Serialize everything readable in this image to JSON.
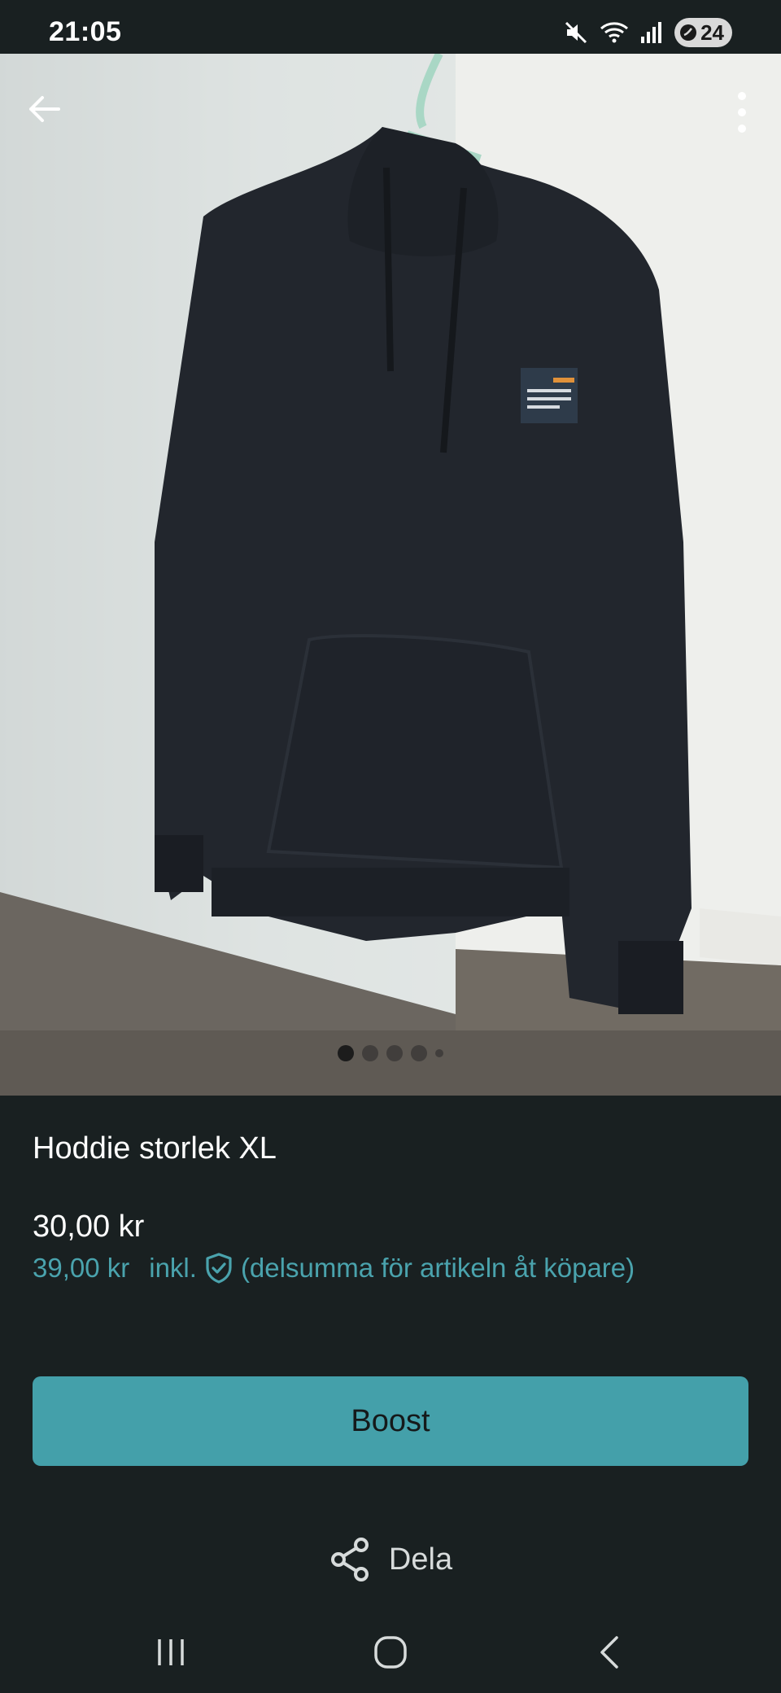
{
  "status_bar": {
    "time": "21:05",
    "battery": "24",
    "icons": [
      "mute-icon",
      "wifi-icon",
      "signal-icon",
      "battery-saver-icon"
    ]
  },
  "photo": {
    "icons": {
      "back": "arrow-left-icon",
      "more": "more-vertical-icon"
    },
    "page_count": 5,
    "current_page": 1
  },
  "product": {
    "title": "Hoddie storlek XL",
    "price": "30,00 kr",
    "price_incl_amount": "39,00 kr",
    "price_incl_word": "inkl.",
    "price_incl_note": "(delsumma för artikeln åt köpare)"
  },
  "actions": {
    "boost_label": "Boost",
    "share_label": "Dela"
  },
  "colors": {
    "background": "#192021",
    "accent": "#44a0aa",
    "accent_text": "#4aa3ad"
  }
}
